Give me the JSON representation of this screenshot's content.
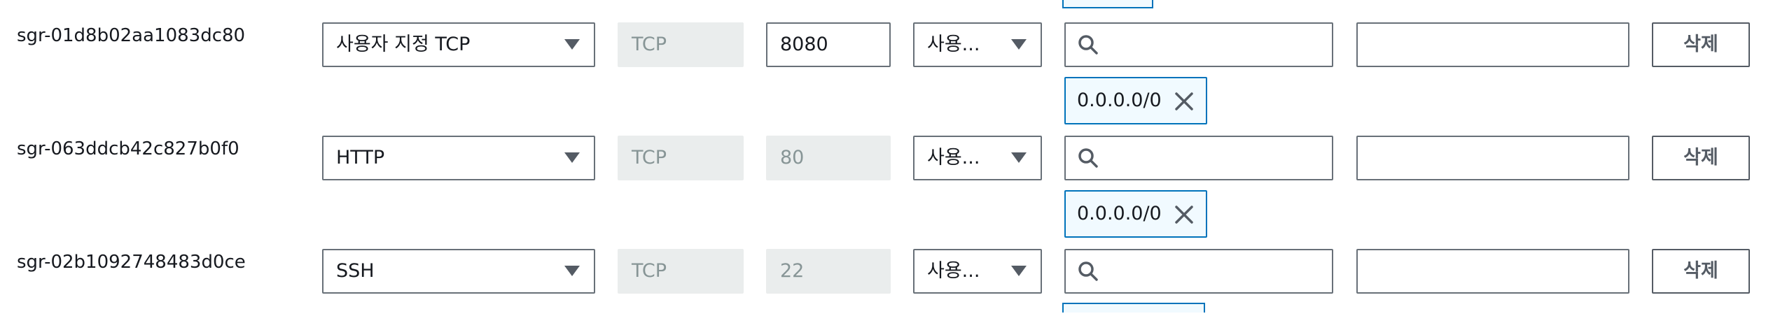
{
  "rules": [
    {
      "id": "sgr-01d8b02aa1083dc80",
      "type": "사용자 지정 TCP",
      "protocol": "TCP",
      "port": "8080",
      "port_editable": true,
      "source_type": "사용...",
      "search_value": "",
      "description": "",
      "delete_label": "삭제",
      "cidr": "0.0.0.0/0"
    },
    {
      "id": "sgr-063ddcb42c827b0f0",
      "type": "HTTP",
      "protocol": "TCP",
      "port": "80",
      "port_editable": false,
      "source_type": "사용...",
      "search_value": "",
      "description": "",
      "delete_label": "삭제",
      "cidr": "0.0.0.0/0"
    },
    {
      "id": "sgr-02b1092748483d0ce",
      "type": "SSH",
      "protocol": "TCP",
      "port": "22",
      "port_editable": false,
      "source_type": "사용...",
      "search_value": "",
      "description": "",
      "delete_label": "삭제",
      "cidr": ""
    }
  ],
  "icons": {
    "search": "search-icon",
    "remove": "close-icon",
    "dropdown": "caret-down-icon"
  },
  "colors": {
    "token_border": "#0073bb",
    "token_bg": "#f1faff",
    "disabled_bg": "#eaeded",
    "border": "#687078"
  }
}
